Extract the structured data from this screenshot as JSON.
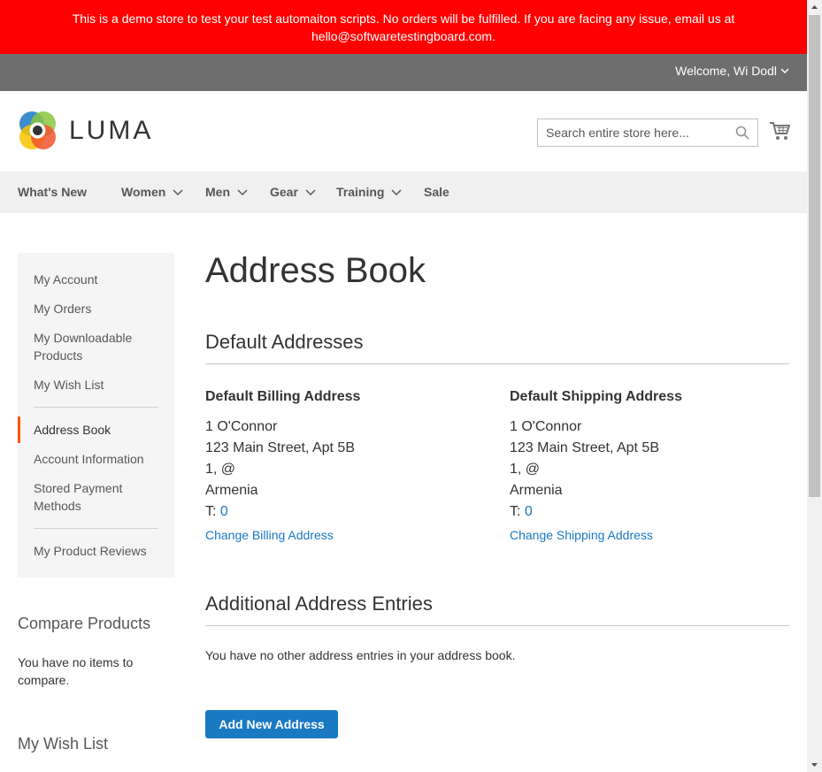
{
  "banner": {
    "text": "This is a demo store to test your test automaiton scripts. No orders will be fulfilled. If you are facing any issue, email us at hello@softwaretestingboard.com."
  },
  "header": {
    "welcome": "Welcome, Wi Dodl"
  },
  "logo": {
    "text": "LUMA"
  },
  "search": {
    "placeholder": "Search entire store here..."
  },
  "nav": {
    "items": [
      {
        "label": "What's New"
      },
      {
        "label": "Women"
      },
      {
        "label": "Men"
      },
      {
        "label": "Gear"
      },
      {
        "label": "Training"
      },
      {
        "label": "Sale"
      }
    ]
  },
  "sidebar": {
    "items": [
      {
        "label": "My Account"
      },
      {
        "label": "My Orders"
      },
      {
        "label": "My Downloadable Products"
      },
      {
        "label": "My Wish List"
      },
      {
        "label": "Address Book"
      },
      {
        "label": "Account Information"
      },
      {
        "label": "Stored Payment Methods"
      },
      {
        "label": "My Product Reviews"
      }
    ]
  },
  "compare": {
    "title": "Compare Products",
    "text": "You have no items to compare."
  },
  "wishlist_block": {
    "title": "My Wish List"
  },
  "main": {
    "title": "Address Book",
    "default_title": "Default Addresses",
    "billing": {
      "heading": "Default Billing Address",
      "name": "1 O'Connor",
      "street": "123 Main Street, Apt 5B",
      "city_line": "1, @",
      "country": "Armenia",
      "tel_prefix": "T: ",
      "tel": "0",
      "link": "Change Billing Address"
    },
    "shipping": {
      "heading": "Default Shipping Address",
      "name": "1 O'Connor",
      "street": "123 Main Street, Apt 5B",
      "city_line": "1, @",
      "country": "Armenia",
      "tel_prefix": "T: ",
      "tel": "0",
      "link": "Change Shipping Address"
    },
    "additional_title": "Additional Address Entries",
    "empty_text": "You have no other address entries in your address book.",
    "add_button": "Add New Address"
  },
  "colors": {
    "banner": "#ff0000",
    "header": "#6e6e6e",
    "link": "#1979c3",
    "active_marker": "#ff5501"
  }
}
